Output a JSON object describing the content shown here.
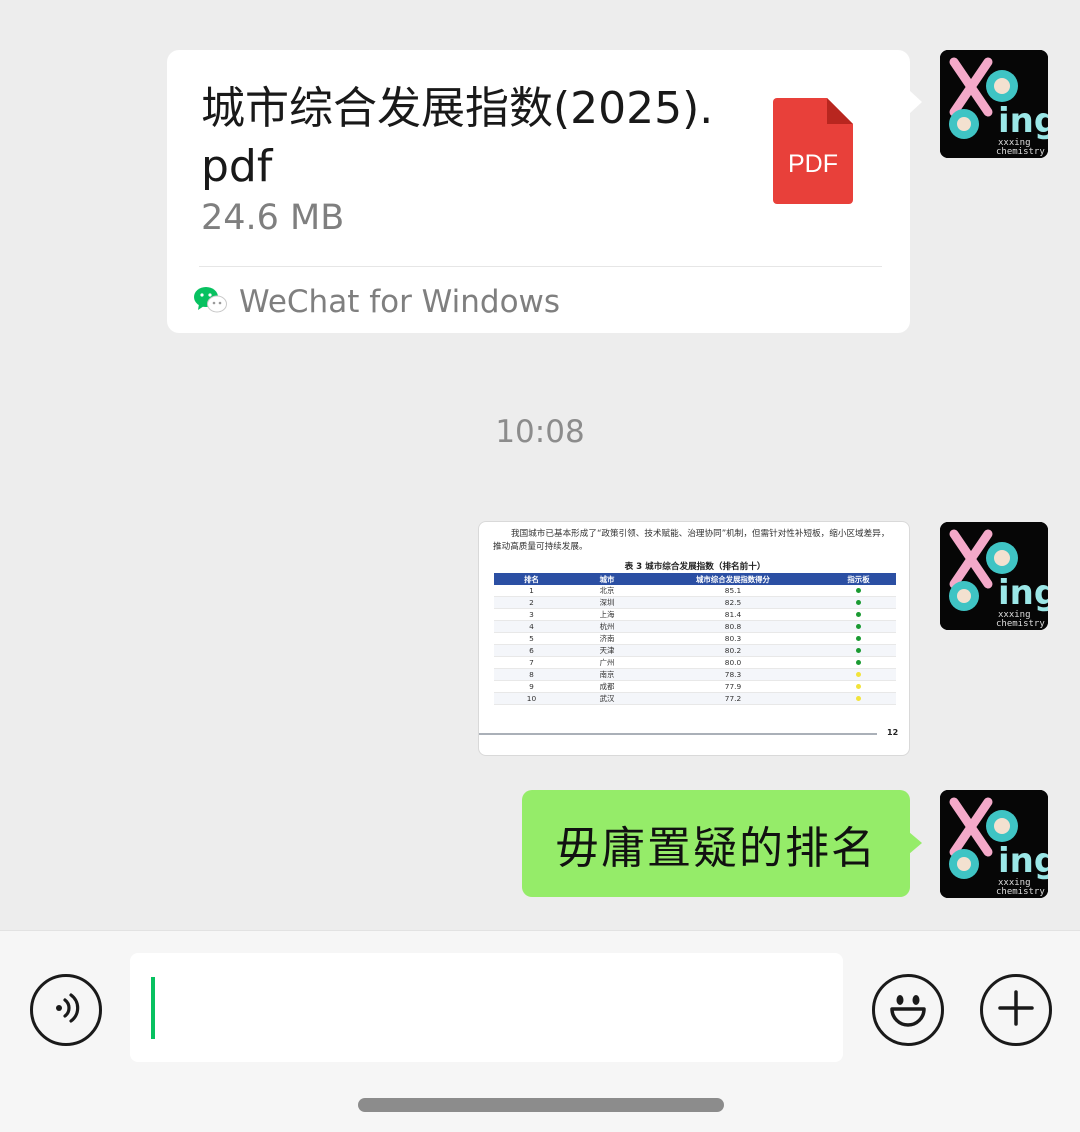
{
  "file_message": {
    "file_name": "城市综合发展指数(2025).pdf",
    "file_size": "24.6 MB",
    "file_type_label": "PDF",
    "source_label": "WeChat for Windows",
    "icon": "pdf-file-icon"
  },
  "timestamp": "10:08",
  "image_message": {
    "intro_line1": "我国城市已基本形成了“政策引领、技术赋能、治理协同”机制，但需针对性补短板，缩小区域差异，",
    "intro_line2": "推动高质量可持续发展。",
    "table_title": "表 3 城市综合发展指数（排名前十）",
    "headers": {
      "rank": "排名",
      "city": "城市",
      "score": "城市综合发展指数得分",
      "indicator": "指示板"
    },
    "rows": [
      {
        "rank": "1",
        "city": "北京",
        "score": "85.1",
        "indicator": "green"
      },
      {
        "rank": "2",
        "city": "深圳",
        "score": "82.5",
        "indicator": "green"
      },
      {
        "rank": "3",
        "city": "上海",
        "score": "81.4",
        "indicator": "green"
      },
      {
        "rank": "4",
        "city": "杭州",
        "score": "80.8",
        "indicator": "green"
      },
      {
        "rank": "5",
        "city": "济南",
        "score": "80.3",
        "indicator": "green"
      },
      {
        "rank": "6",
        "city": "天津",
        "score": "80.2",
        "indicator": "green"
      },
      {
        "rank": "7",
        "city": "广州",
        "score": "80.0",
        "indicator": "green"
      },
      {
        "rank": "8",
        "city": "南京",
        "score": "78.3",
        "indicator": "yellow"
      },
      {
        "rank": "9",
        "city": "成都",
        "score": "77.9",
        "indicator": "yellow"
      },
      {
        "rank": "10",
        "city": "武汉",
        "score": "77.2",
        "indicator": "yellow"
      }
    ],
    "page_number": "12"
  },
  "text_message": {
    "text": "毋庸置疑的排名"
  },
  "avatar": {
    "label_top": "xxxing",
    "label_bottom": "chemistry"
  },
  "input_bar": {
    "value": "",
    "icons": [
      "voice-icon",
      "emoji-icon",
      "plus-icon"
    ]
  },
  "colors": {
    "background": "#ededed",
    "bubble_green": "#95ec69",
    "wechat_green": "#07c160",
    "pdf_red": "#e8403a",
    "table_header_blue": "#2b4fa3",
    "indicator_green": "#1a9a32",
    "indicator_yellow": "#f2e33a"
  }
}
